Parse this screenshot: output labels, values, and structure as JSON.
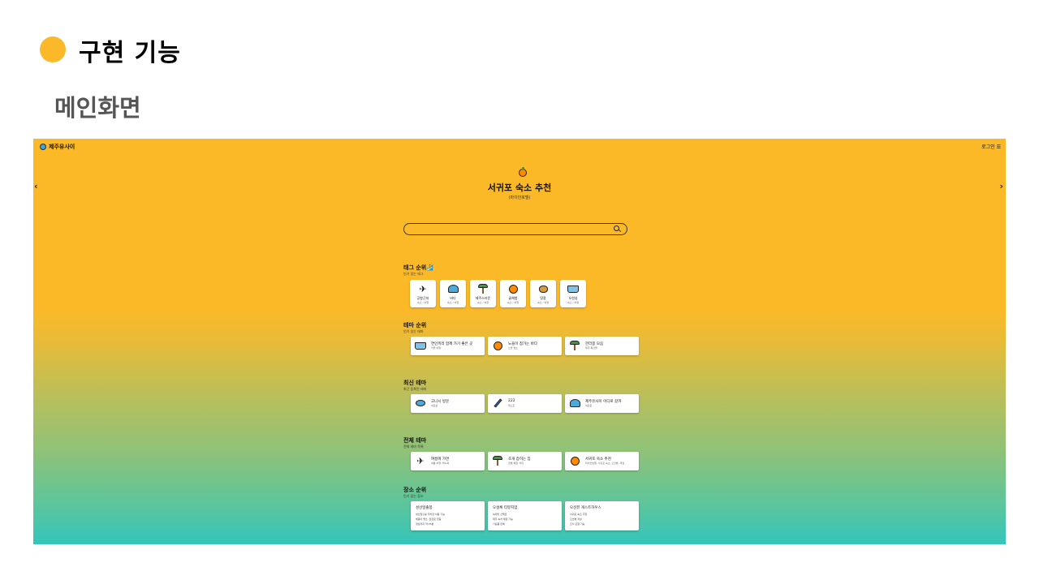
{
  "slide": {
    "title": "구현 기능",
    "subtitle": "메인화면",
    "bullet_color": "#fbb929"
  },
  "app": {
    "brand": "제주유사이",
    "login": "로그인 ☰",
    "prev_arrow": "‹",
    "next_arrow": "›",
    "hero": {
      "icon": "tangerine-icon",
      "title": "서귀포 숙소 추천",
      "subtitle": "(마이안호텔)"
    },
    "search": {
      "placeholder": "",
      "icon": "search-icon"
    },
    "tags_section": {
      "title": "태그 순위🏄",
      "subtitle": "인기 있는 태그",
      "items": [
        {
          "name": "공항근처",
          "count": "숙소 / 여행",
          "icon": "plane-icon"
        },
        {
          "name": "바다",
          "count": "숙소 / 여행",
          "icon": "wave-icon"
        },
        {
          "name": "제주스러운",
          "count": "숙소 / 여행",
          "icon": "palm-tree-icon"
        },
        {
          "name": "귤체험",
          "count": "숙소 / 여행",
          "icon": "tangerine-icon"
        },
        {
          "name": "땅콩",
          "count": "숙소 / 여행",
          "icon": "peanut-icon"
        },
        {
          "name": "오션뷰",
          "count": "숙소 / 여행",
          "icon": "ship-icon"
        }
      ]
    },
    "theme_rank": {
      "title": "테마 순위",
      "subtitle": "인기 있는 테마",
      "items": [
        {
          "name": "연인끼리 함께 가기 좋은 곳",
          "meta": "커플 여행",
          "icon": "ship-icon"
        },
        {
          "name": "노을이 참가는 바다",
          "meta": "노을 명소",
          "icon": "tangerine-icon"
        },
        {
          "name": "한라봉 모음",
          "meta": "제주 특산물",
          "icon": "palm-tree-icon"
        }
      ]
    },
    "latest_theme": {
      "title": "최신 테마",
      "subtitle": "최근 등록된 테마",
      "items": [
        {
          "name": "고니시 방문",
          "meta": "새로운",
          "icon": "fish-icon"
        },
        {
          "name": "222",
          "meta": "테스트",
          "icon": "pen-icon"
        },
        {
          "name": "제주유사이 어디로 갈까",
          "meta": "새로운",
          "icon": "wave-icon"
        }
      ]
    },
    "all_theme": {
      "title": "전체 테마",
      "subtitle": "전체 테마 목록",
      "items": [
        {
          "name": "여름에 가면",
          "meta": "여름 여행, 해수욕",
          "icon": "plane-icon"
        },
        {
          "name": "조개 잡히는 집",
          "meta": "갯벌 체험, 바다",
          "icon": "palm-tree-icon"
        },
        {
          "name": "서귀포 숙소 추천",
          "meta": "마이안호텔, 서귀포 숙소, 오션뷰, 객실",
          "icon": "tangerine-icon"
        }
      ]
    },
    "place_rank": {
      "title": "장소 순위",
      "subtitle": "인기 있는 장소",
      "items": [
        {
          "name": "성산일출봉",
          "lines": [
            "성산일출봉 주차장 이용 가능",
            "해돋이 명소, 입장료 있음",
            "정상까지 약 25분"
          ]
        },
        {
          "name": "오설록 티뮤지엄",
          "lines": [
            "녹차밭 산책로",
            "제주 녹차 체험 가능",
            "기념품 판매"
          ]
        },
        {
          "name": "오션뷰 게스트하우스",
          "lines": [
            "서귀포 숙소 추천",
            "오션뷰 객실",
            "조식 포함 가능"
          ]
        }
      ]
    }
  }
}
